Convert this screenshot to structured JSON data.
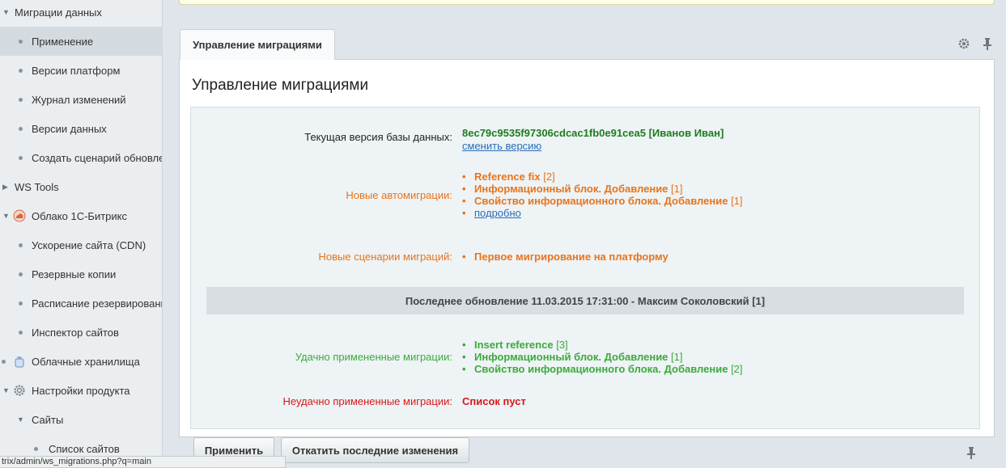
{
  "sidebar": {
    "items": [
      {
        "label": "Миграции данных",
        "type": "group",
        "expanded": true
      },
      {
        "label": "Применение",
        "type": "sub",
        "active": true
      },
      {
        "label": "Версии платформ",
        "type": "sub"
      },
      {
        "label": "Журнал изменений",
        "type": "sub"
      },
      {
        "label": "Версии данных",
        "type": "sub"
      },
      {
        "label": "Создать сценарий обновле",
        "type": "sub"
      },
      {
        "label": "WS Tools",
        "type": "group",
        "expanded": false
      },
      {
        "label": "Облако 1С-Битрикс",
        "type": "group",
        "expanded": true,
        "icon": "cloud-icon"
      },
      {
        "label": "Ускорение сайта (CDN)",
        "type": "sub"
      },
      {
        "label": "Резервные копии",
        "type": "sub"
      },
      {
        "label": "Расписание резервировани",
        "type": "sub"
      },
      {
        "label": "Инспектор сайтов",
        "type": "sub"
      },
      {
        "label": "Облачные хранилища",
        "type": "group",
        "icon": "storage-icon"
      },
      {
        "label": "Настройки продукта",
        "type": "group",
        "expanded": true,
        "icon": "gear-icon"
      },
      {
        "label": "Сайты",
        "type": "subgroup",
        "expanded": true
      },
      {
        "label": "Список сайтов",
        "type": "subsub"
      }
    ]
  },
  "tab": {
    "label": "Управление миграциями"
  },
  "panel": {
    "title": "Управление миграциями",
    "current_version": {
      "label": "Текущая версия базы данных:",
      "hash": "8ec79c9535f97306cdcac1fb0e91cea5 [Иванов Иван]",
      "link": "сменить версию"
    },
    "auto_migrations": {
      "label": "Новые автомиграции:",
      "items": [
        {
          "name": "Reference fix",
          "count": "[2]"
        },
        {
          "name": "Информационный блок. Добавление",
          "count": "[1]"
        },
        {
          "name": "Свойство информационного блока. Добавление",
          "count": "[1]"
        }
      ],
      "details_link": "подробно"
    },
    "scenarios": {
      "label": "Новые сценарии миграций:",
      "items": [
        "Первое мигрирование на платформу"
      ]
    },
    "last_update": "Последнее обновление 11.03.2015 17:31:00 - Максим Соколовский [1]",
    "success": {
      "label": "Удачно примененные миграции:",
      "items": [
        {
          "name": "Insert reference",
          "count": "[3]"
        },
        {
          "name": "Информационный блок. Добавление",
          "count": "[1]"
        },
        {
          "name": "Свойство информационного блока. Добавление",
          "count": "[2]"
        }
      ]
    },
    "failed": {
      "label": "Неудачно примененные миграции:",
      "value": "Список пуст"
    }
  },
  "buttons": {
    "apply": "Применить",
    "rollback": "Откатить последние изменения"
  },
  "statusbar": {
    "url": "trix/admin/ws_migrations.php?q=main"
  },
  "colors": {
    "orange": "#e8741c",
    "green": "#3caa3c",
    "dark_green": "#1e7d1e",
    "red": "#d41a1a",
    "link": "#2b6db5"
  }
}
